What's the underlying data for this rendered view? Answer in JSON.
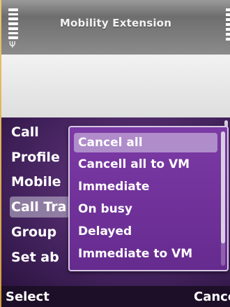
{
  "header": {
    "title": "Mobility Extension"
  },
  "menu": {
    "items": [
      "Call",
      "Profile",
      "Mobile",
      "Call Tra",
      "Group",
      "Set ab"
    ],
    "selected_index": 3
  },
  "popup": {
    "options": [
      "Cancel all",
      "Cancell all to VM",
      "Immediate",
      "On busy",
      "Delayed",
      "Immediate to VM"
    ],
    "highlighted_index": 0
  },
  "softkeys": {
    "left": "Select",
    "right": "Cance"
  }
}
